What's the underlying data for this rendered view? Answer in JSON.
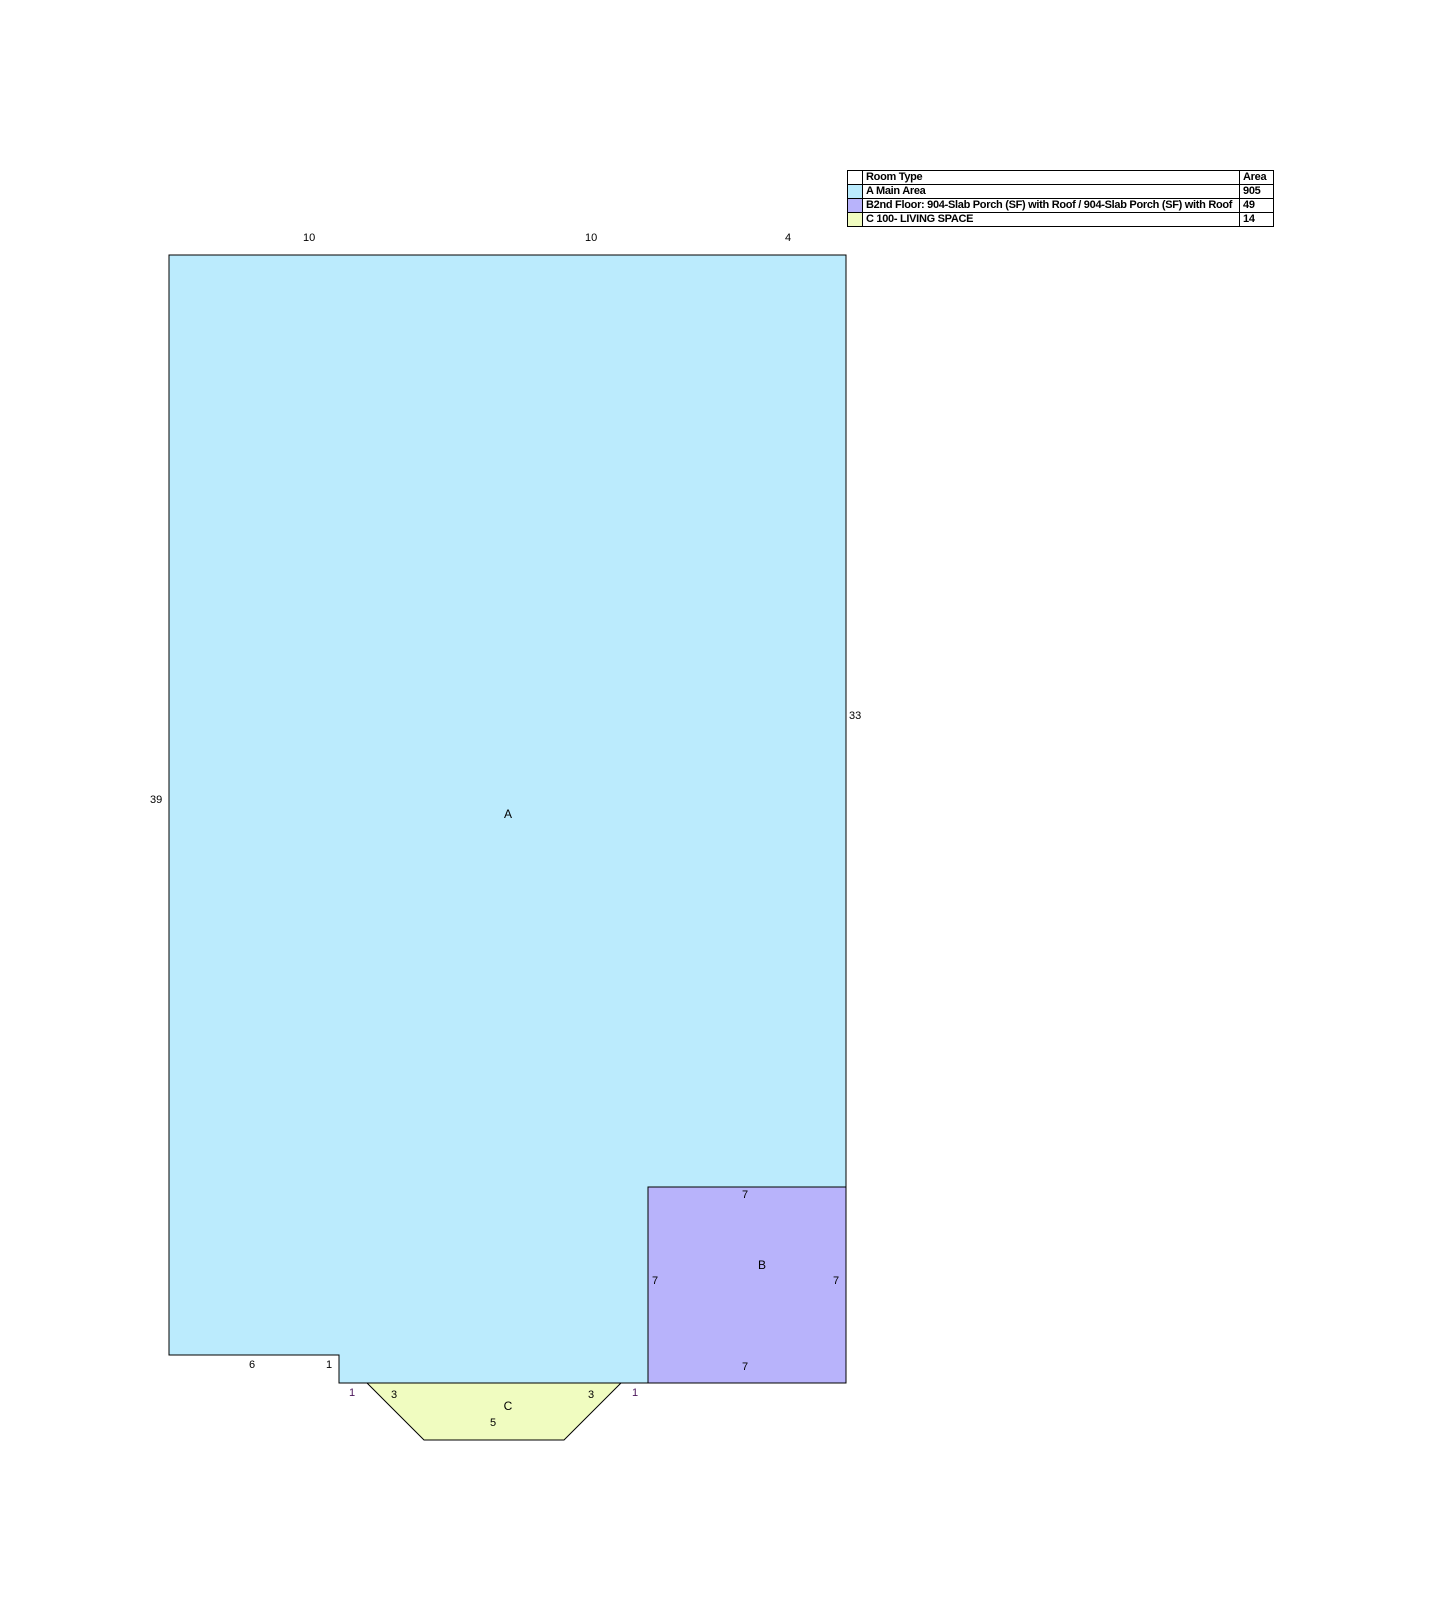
{
  "legend": {
    "header_type": "Room Type",
    "header_area": "Area",
    "rows": [
      {
        "name": "A Main Area",
        "area": "905",
        "color": "#bbebfd"
      },
      {
        "name": "B2nd Floor: 904-Slab Porch (SF) with Roof / 904-Slab Porch (SF) with Roof",
        "area": "49",
        "color": "#b8b3fb"
      },
      {
        "name": "C 100- LIVING SPACE",
        "area": "14",
        "color": "#f0fcc0"
      }
    ]
  },
  "rooms": {
    "a": {
      "label": "A",
      "color": "#bbebfd"
    },
    "b": {
      "label": "B",
      "color": "#b8b3fb"
    },
    "c": {
      "label": "C",
      "color": "#f0fcc0"
    }
  },
  "dimensions": {
    "top_left": "10",
    "top_mid": "10",
    "top_right": "4",
    "right_side": "33",
    "left_side": "39",
    "bottom_left": "6",
    "step_left": "1",
    "b_top": "7",
    "b_left": "7",
    "b_right": "7",
    "b_bottom": "7",
    "c_left_offset": "1",
    "c_left_slope": "3",
    "c_bottom": "5",
    "c_right_slope": "3",
    "c_right_offset": "1"
  }
}
